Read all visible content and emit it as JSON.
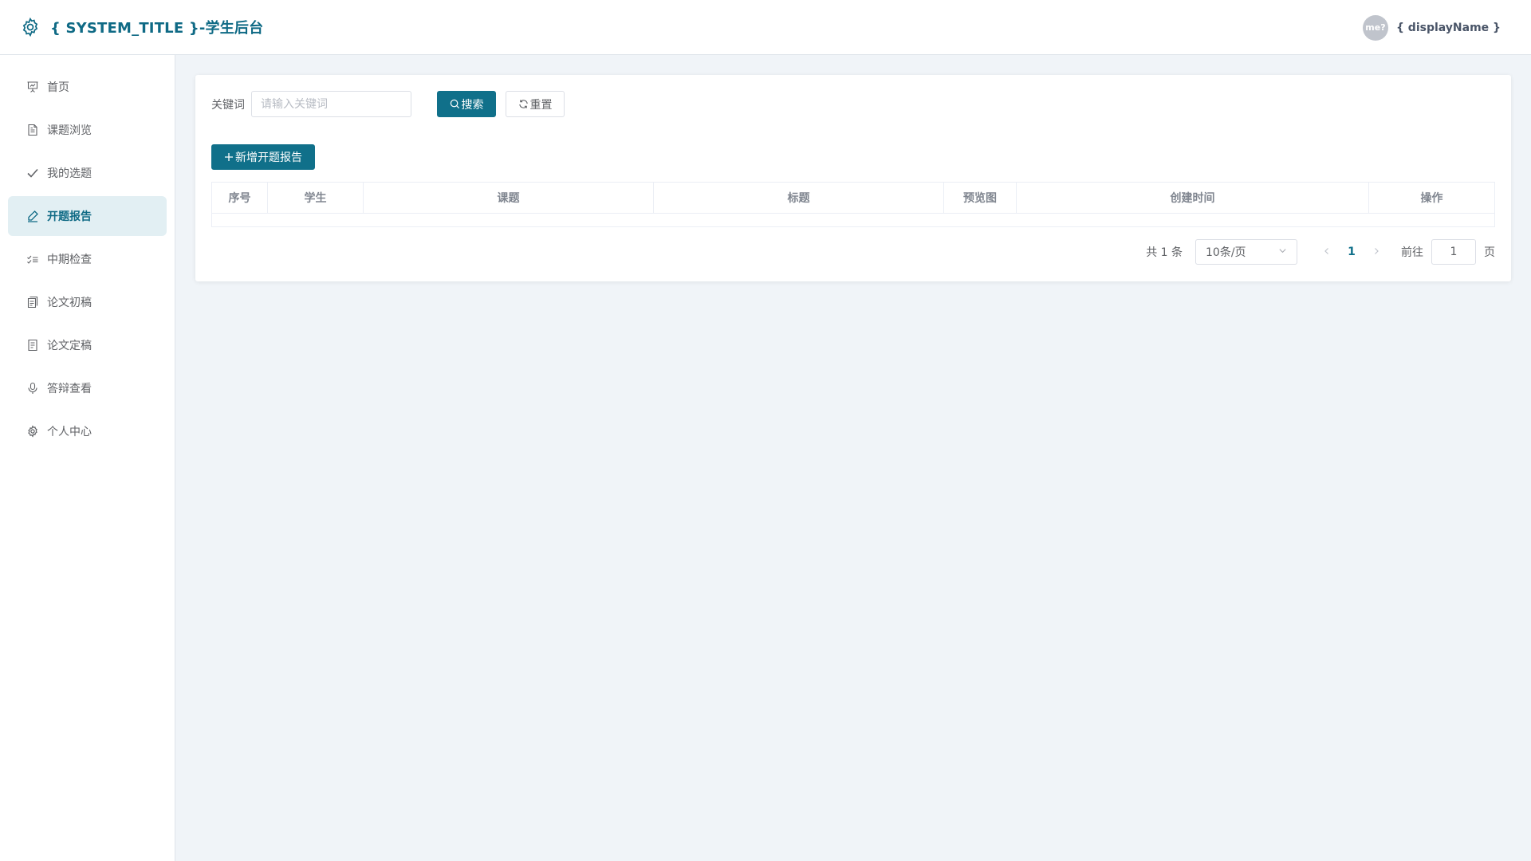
{
  "header": {
    "title": "{ SYSTEM_TITLE }-学生后台",
    "avatar_text": "me?",
    "username": "{ displayName }"
  },
  "sidebar": {
    "items": [
      {
        "label": "首页",
        "icon": "presentation-icon",
        "active": false
      },
      {
        "label": "课题浏览",
        "icon": "document-icon",
        "active": false
      },
      {
        "label": "我的选题",
        "icon": "check-icon",
        "active": false
      },
      {
        "label": "开题报告",
        "icon": "edit-pen-icon",
        "active": true
      },
      {
        "label": "中期检查",
        "icon": "checklist-icon",
        "active": false
      },
      {
        "label": "论文初稿",
        "icon": "copy-document-icon",
        "active": false
      },
      {
        "label": "论文定稿",
        "icon": "document-icon",
        "active": false
      },
      {
        "label": "答辩查看",
        "icon": "microphone-icon",
        "active": false
      },
      {
        "label": "个人中心",
        "icon": "gear-icon",
        "active": false
      }
    ]
  },
  "search": {
    "label": "关键词",
    "placeholder": "请输入关键词",
    "value": "",
    "search_button": "搜索",
    "reset_button": "重置"
  },
  "toolbar": {
    "add_button": "新增开题报告"
  },
  "table": {
    "columns": [
      "序号",
      "学生",
      "课题",
      "标题",
      "预览图",
      "创建时间",
      "操作"
    ],
    "rows": []
  },
  "pagination": {
    "total_text": "共 1 条",
    "page_size": "10条/页",
    "current_page": "1",
    "goto_label": "前往",
    "goto_value": "1",
    "page_suffix": "页"
  },
  "colors": {
    "primary": "#10708a",
    "title": "#0f6a85",
    "active_bg": "#e2eff3",
    "page_bg": "#f0f4f8"
  }
}
